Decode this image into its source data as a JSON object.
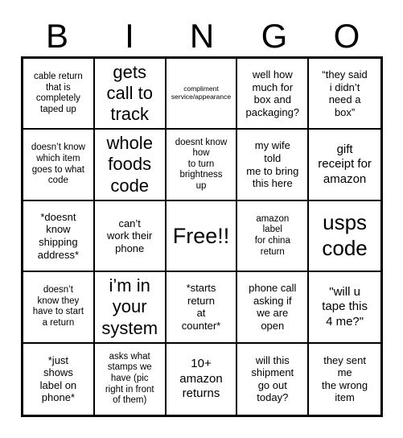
{
  "header": {
    "letters": [
      "B",
      "I",
      "N",
      "G",
      "O"
    ]
  },
  "grid": {
    "rows": 5,
    "columns": 5,
    "cells": [
      {
        "text": "cable return\nthat is\ncompletely\ntaped up",
        "size": "sz-sm",
        "free": false
      },
      {
        "text": "gets\ncall to\ntrack",
        "size": "sz-xl",
        "free": false
      },
      {
        "text": "compliment\nservice/appearance",
        "size": "sz-xs",
        "free": false
      },
      {
        "text": "well how\nmuch for\nbox and\npackaging?",
        "size": "sz-md",
        "free": false
      },
      {
        "text": "“they said\ni didn’t\nneed a\nbox”",
        "size": "sz-md",
        "free": false
      },
      {
        "text": "doesn’t know\nwhich item\ngoes to what\ncode",
        "size": "sz-sm",
        "free": false
      },
      {
        "text": "whole\nfoods\ncode",
        "size": "sz-xl",
        "free": false
      },
      {
        "text": "doesnt know\nhow\nto turn\nbrightness\nup",
        "size": "sz-sm",
        "free": false
      },
      {
        "text": "my wife\ntold\nme to bring\nthis here",
        "size": "sz-md",
        "free": false
      },
      {
        "text": "gift\nreceipt for\namazon",
        "size": "sz-lg",
        "free": false
      },
      {
        "text": "*doesnt\nknow\nshipping\naddress*",
        "size": "sz-md",
        "free": false
      },
      {
        "text": "can’t\nwork their\nphone",
        "size": "sz-md",
        "free": false
      },
      {
        "text": "Free!!",
        "size": "sz-free",
        "free": true
      },
      {
        "text": "amazon\nlabel\nfor china\nreturn",
        "size": "sz-sm",
        "free": false
      },
      {
        "text": "usps\ncode",
        "size": "sz-xxl",
        "free": false
      },
      {
        "text": "doesn’t\nknow they\nhave to start\na return",
        "size": "sz-sm",
        "free": false
      },
      {
        "text": "i’m in\nyour\nsystem",
        "size": "sz-xl",
        "free": false
      },
      {
        "text": "*starts\nreturn\nat\ncounter*",
        "size": "sz-md",
        "free": false
      },
      {
        "text": "phone call\nasking if\nwe are\nopen",
        "size": "sz-md",
        "free": false
      },
      {
        "text": "\"will u\ntape this\n4 me?\"",
        "size": "sz-lg",
        "free": false
      },
      {
        "text": "*just\nshows\nlabel on\nphone*",
        "size": "sz-md",
        "free": false
      },
      {
        "text": "asks what\nstamps we\nhave (pic\nright in front\nof them)",
        "size": "sz-sm",
        "free": false
      },
      {
        "text": "10+\namazon\nreturns",
        "size": "sz-lg",
        "free": false
      },
      {
        "text": "will this\nshipment\ngo out\ntoday?",
        "size": "sz-md",
        "free": false
      },
      {
        "text": "they sent\nme\nthe wrong\nitem",
        "size": "sz-md",
        "free": false
      }
    ]
  }
}
